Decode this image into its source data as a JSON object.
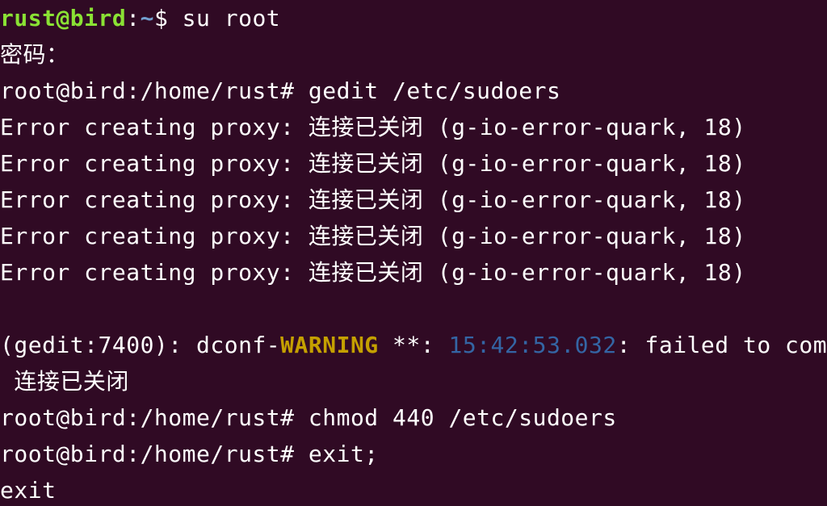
{
  "colors": {
    "background": "#300a24",
    "foreground": "#ffffff",
    "prompt_user": "#8ae234",
    "prompt_path": "#729fcf",
    "warning": "#c4a000",
    "timestamp": "#3465a4"
  },
  "line1": {
    "user_host": "rust@bird",
    "colon": ":",
    "path": "~",
    "dollar": "$",
    "command": " su root"
  },
  "line2": {
    "text": "密码："
  },
  "line3": {
    "prompt": "root@bird:/home/rust# ",
    "command": "gedit /etc/sudoers"
  },
  "errors": [
    "Error creating proxy: 连接已关闭 (g-io-error-quark, 18)",
    "Error creating proxy: 连接已关闭 (g-io-error-quark, 18)",
    "Error creating proxy: 连接已关闭 (g-io-error-quark, 18)",
    "Error creating proxy: 连接已关闭 (g-io-error-quark, 18)",
    "Error creating proxy: 连接已关闭 (g-io-error-quark, 18)"
  ],
  "warning_line": {
    "prefix": "(gedit:7400): dconf-",
    "level": "WARNING",
    "stars": " **: ",
    "timestamp": "15:42:53.032",
    "message": ": failed to comm"
  },
  "warning_cont": {
    "text": " 连接已关闭"
  },
  "line_chmod": {
    "prompt": "root@bird:/home/rust# ",
    "command": "chmod 440 /etc/sudoers"
  },
  "line_exitcmd": {
    "prompt": "root@bird:/home/rust# ",
    "command": "exit;"
  },
  "line_exit": {
    "text": "exit"
  }
}
